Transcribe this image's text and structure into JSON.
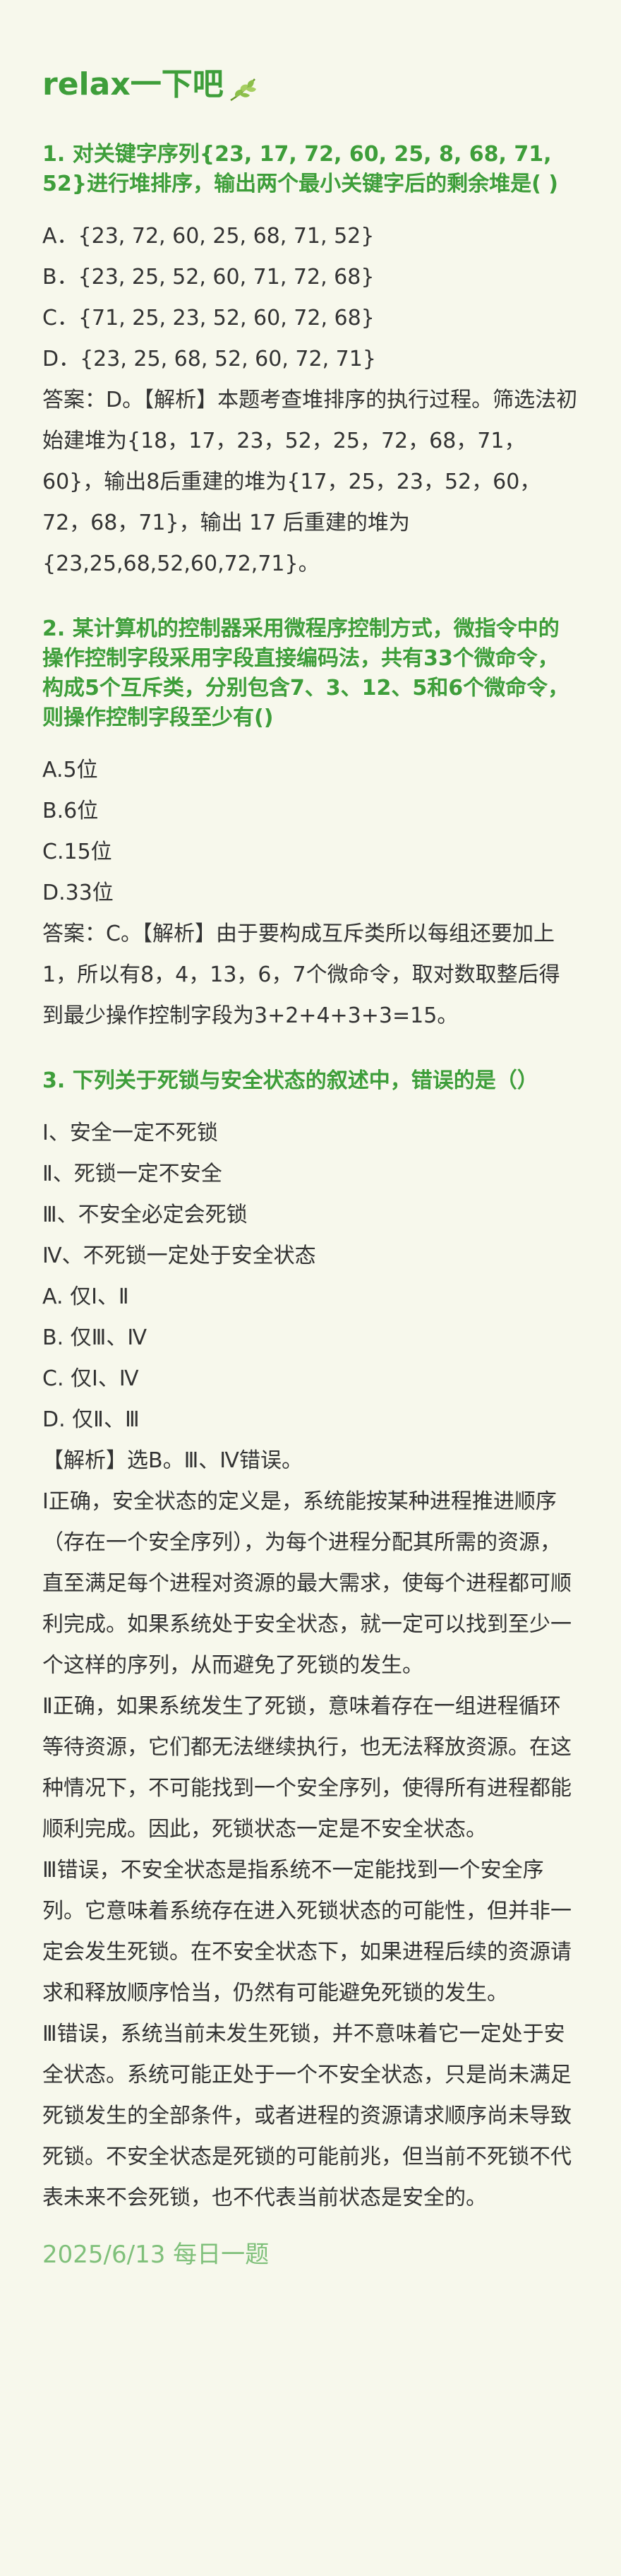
{
  "header": {
    "title": "relax一下吧",
    "icon": "leaf-icon"
  },
  "colors": {
    "background": "#f7f8ec",
    "accent": "#3e9e3a",
    "footer": "#7fc07a",
    "text": "#333333"
  },
  "questions": [
    {
      "title": "1. 对关键字序列{23, 17, 72, 60, 25, 8, 68, 71, 52}进行堆排序，输出两个最小关键字后的剩余堆是( )",
      "options": [
        "A．{23, 72, 60, 25, 68, 71, 52}",
        "B．{23, 25, 52, 60, 71, 72, 68}",
        "C．{71, 25, 23, 52, 60, 72, 68}",
        "D．{23, 25, 68, 52, 60, 72, 71}"
      ],
      "answer": "答案：D。【解析】本题考查堆排序的执行过程。筛选法初始建堆为{18，17，23，52，25，72，68，71，60}，输出8后重建的堆为{17，25，23，52，60，72，68，71}，输出 17 后重建的堆为{23,25,68,52,60,72,71}。"
    },
    {
      "title": "2. 某计算机的控制器采用微程序控制方式，微指令中的操作控制字段采用字段直接编码法，共有33个微命令，构成5个互斥类，分别包含7、3、12、5和6个微命令，则操作控制字段至少有()",
      "options": [
        "A.5位",
        "B.6位",
        "C.15位",
        "D.33位"
      ],
      "answer": "答案：C。【解析】由于要构成互斥类所以每组还要加上1，所以有8，4，13，6，7个微命令，取对数取整后得到最少操作控制字段为3+2+4+3+3=15。"
    },
    {
      "title": "3. 下列关于死锁与安全状态的叙述中，错误的是（）",
      "statements": [
        "Ⅰ、安全一定不死锁",
        "Ⅱ、死锁一定不安全",
        "Ⅲ、不安全必定会死锁",
        "Ⅳ、不死锁一定处于安全状态"
      ],
      "options": [
        "A. 仅Ⅰ、Ⅱ",
        "B. 仅Ⅲ、Ⅳ",
        "C. 仅Ⅰ、Ⅳ",
        "D. 仅Ⅱ、Ⅲ"
      ],
      "analysis": [
        "【解析】选B。Ⅲ、Ⅳ错误。",
        "Ⅰ正确，安全状态的定义是，系统能按某种进程推进顺序（存在一个安全序列），为每个进程分配其所需的资源，直至满足每个进程对资源的最大需求，使每个进程都可顺利完成。如果系统处于安全状态，就一定可以找到至少一个这样的序列，从而避免了死锁的发生。",
        "Ⅱ正确，如果系统发生了死锁，意味着存在一组进程循环等待资源，它们都无法继续执行，也无法释放资源。在这种情况下，不可能找到一个安全序列，使得所有进程都能顺利完成。因此，死锁状态一定是不安全状态。",
        "Ⅲ错误，不安全状态是指系统不一定能找到一个安全序列。它意味着系统存在进入死锁状态的可能性，但并非一定会发生死锁。在不安全状态下，如果进程后续的资源请求和释放顺序恰当，仍然有可能避免死锁的发生。",
        "Ⅲ错误，系统当前未发生死锁，并不意味着它一定处于安全状态。系统可能正处于一个不安全状态，只是尚未满足死锁发生的全部条件，或者进程的资源请求顺序尚未导致死锁。不安全状态是死锁的可能前兆，但当前不死锁不代表未来不会死锁，也不代表当前状态是安全的。"
      ]
    }
  ],
  "footer": {
    "text": "2025/6/13 每日一题"
  }
}
